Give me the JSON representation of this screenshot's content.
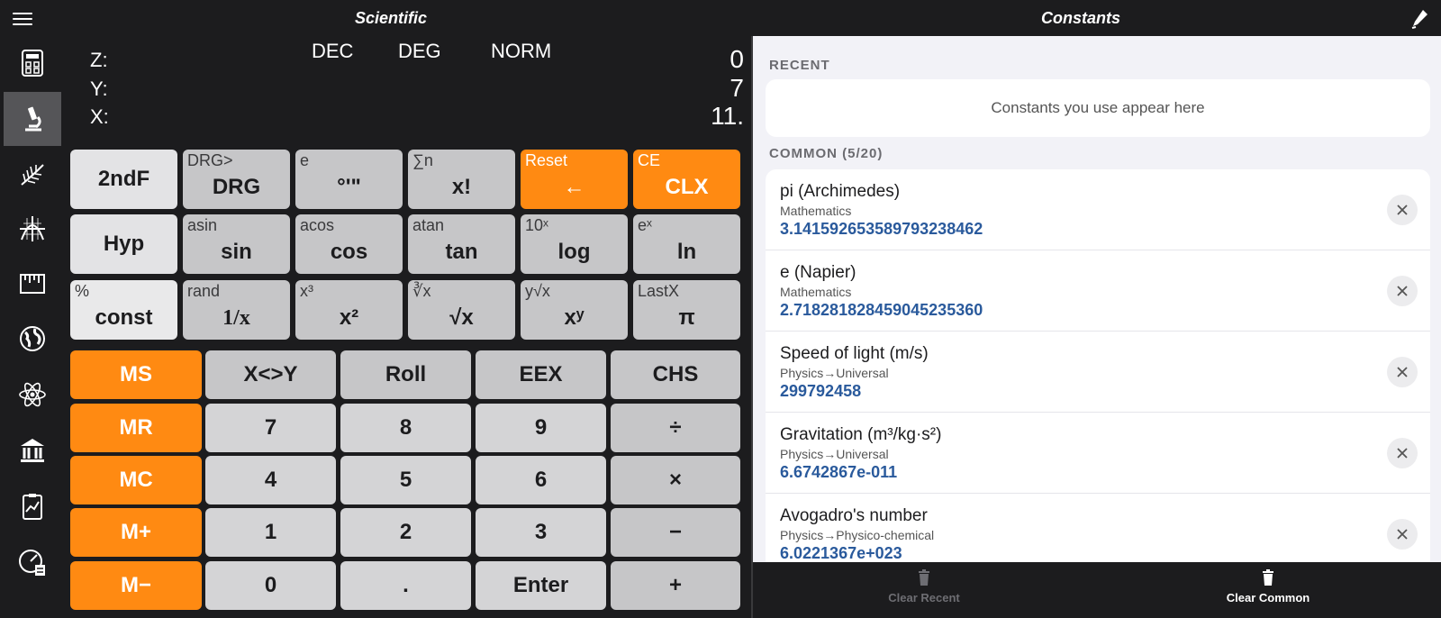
{
  "header": {
    "left_title": "Scientific",
    "right_title": "Constants"
  },
  "sidebar": {
    "items": [
      {
        "icon": "calculator-icon"
      },
      {
        "icon": "microscope-icon",
        "active": true
      },
      {
        "icon": "fern-icon"
      },
      {
        "icon": "graph-icon"
      },
      {
        "icon": "ruler-icon"
      },
      {
        "icon": "globe-icon"
      },
      {
        "icon": "atom-icon"
      },
      {
        "icon": "bank-icon"
      },
      {
        "icon": "clipboard-chart-icon"
      },
      {
        "icon": "gauge-calculator-icon"
      }
    ]
  },
  "display": {
    "modes": [
      "DEC",
      "DEG",
      "NORM"
    ],
    "stack": [
      {
        "label": "Z:",
        "value": "0"
      },
      {
        "label": "Y:",
        "value": "7"
      },
      {
        "label": "X:",
        "value": "11."
      }
    ]
  },
  "keys": {
    "row1": [
      {
        "sub": "",
        "main": "2ndF"
      },
      {
        "sub": "DRG>",
        "main": "DRG"
      },
      {
        "sub": "e",
        "main": "°'\""
      },
      {
        "sub": "∑n",
        "main": "x!"
      },
      {
        "sub": "Reset",
        "main": "←"
      },
      {
        "sub": "CE",
        "main": "CLX"
      }
    ],
    "row2": [
      {
        "sub": "",
        "main": "Hyp"
      },
      {
        "sub": "asin",
        "main": "sin"
      },
      {
        "sub": "acos",
        "main": "cos"
      },
      {
        "sub": "atan",
        "main": "tan"
      },
      {
        "sub": "10ˣ",
        "main": "log"
      },
      {
        "sub": "eˣ",
        "main": "ln"
      }
    ],
    "row3": [
      {
        "sub": "%",
        "main": "const"
      },
      {
        "sub": "rand",
        "main": "1/x"
      },
      {
        "sub": "x³",
        "main": "x²"
      },
      {
        "sub": "∛x",
        "main": "√x"
      },
      {
        "sub": "y√x",
        "main": "xʸ"
      },
      {
        "sub": "LastX",
        "main": "π"
      }
    ],
    "grid": [
      [
        "MS",
        "X<>Y",
        "Roll",
        "EEX",
        "CHS"
      ],
      [
        "MR",
        "7",
        "8",
        "9",
        "÷"
      ],
      [
        "MC",
        "4",
        "5",
        "6",
        "×"
      ],
      [
        "M+",
        "1",
        "2",
        "3",
        "−"
      ],
      [
        "M−",
        "0",
        ".",
        "Enter",
        "+"
      ]
    ]
  },
  "constants": {
    "recent_header": "RECENT",
    "recent_empty": "Constants you use appear here",
    "common_header": "COMMON (5/20)",
    "items": [
      {
        "name": "pi (Archimedes)",
        "category": "Mathematics",
        "value": "3.14159265358979323846 2"
      },
      {
        "name": "e (Napier)",
        "category": "Mathematics",
        "value": "2.718281828459045235360"
      },
      {
        "name": "Speed of light (m/s)",
        "category": "Physics→Universal",
        "value": "299792458"
      },
      {
        "name": "Gravitation (m³/kg·s²)",
        "category": "Physics→Universal",
        "value": "6.6742867e-011"
      },
      {
        "name": "Avogadro's number",
        "category": "Physics→Physico-chemical",
        "value": "6.0221367e+023"
      }
    ]
  },
  "bottom": {
    "clear_recent": "Clear Recent",
    "clear_common": "Clear Common"
  },
  "colors": {
    "orange": "#ff8a12",
    "value_blue": "#2a5a9c"
  }
}
